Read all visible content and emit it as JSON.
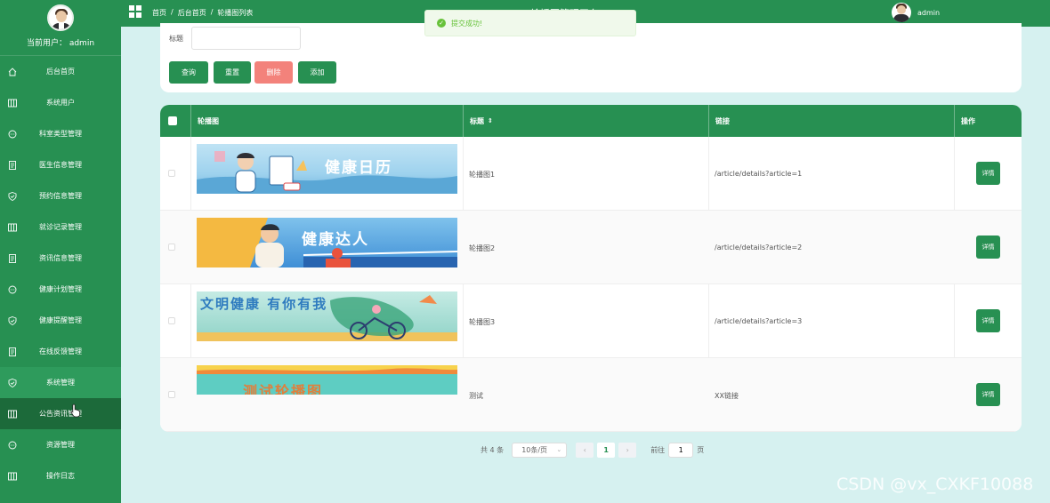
{
  "sidebar": {
    "current_user": "当前用户： admin",
    "items": [
      {
        "label": "后台首页",
        "icon": "home-icon"
      },
      {
        "label": "系统用户",
        "icon": "columns-icon"
      },
      {
        "label": "科室类型管理",
        "icon": "chat-icon"
      },
      {
        "label": "医生信息管理",
        "icon": "document-icon"
      },
      {
        "label": "预约信息管理",
        "icon": "shield-check-icon"
      },
      {
        "label": "就诊记录管理",
        "icon": "columns-icon"
      },
      {
        "label": "资讯信息管理",
        "icon": "document-icon"
      },
      {
        "label": "健康计划管理",
        "icon": "chat-icon"
      },
      {
        "label": "健康提醒管理",
        "icon": "shield-check-icon"
      },
      {
        "label": "在线反馈管理",
        "icon": "document-icon"
      },
      {
        "label": "系统管理",
        "icon": "shield-check-icon"
      },
      {
        "label": "公告资讯管理",
        "icon": "columns-icon"
      },
      {
        "label": "资源管理",
        "icon": "chat-icon"
      },
      {
        "label": "操作日志",
        "icon": "columns-icon"
      }
    ]
  },
  "header": {
    "breadcrumb": [
      "首页",
      "/",
      "后台首页",
      "/",
      "轮播图列表"
    ],
    "system_title": "轮播图管理平台",
    "user": "admin"
  },
  "toast": {
    "message": "提交成功!"
  },
  "search": {
    "label": "标题",
    "placeholder": "",
    "buttons": {
      "query": "查询",
      "reset": "重置",
      "delete": "删除",
      "add": "添加"
    }
  },
  "table": {
    "headers": {
      "image": "轮播图",
      "title": "标题",
      "link": "链接",
      "action": "操作"
    },
    "rows": [
      {
        "banner_text": "健康日历",
        "title": "轮播图1",
        "link": "/article/details?article=1",
        "action": "详情"
      },
      {
        "banner_text": "健康达人",
        "title": "轮播图2",
        "link": "/article/details?article=2",
        "action": "详情"
      },
      {
        "banner_text": "文明健康 有你有我",
        "title": "轮播图3",
        "link": "/article/details?article=3",
        "action": "详情"
      },
      {
        "banner_text": "测试轮播图",
        "title": "测试",
        "link": "XX链接",
        "action": "详情"
      }
    ]
  },
  "pagination": {
    "total": "共 4 条",
    "page_size": "10条/页",
    "current_page": "1",
    "goto_label": "前往",
    "goto_value": "1",
    "page_suffix": "页"
  },
  "watermark": "CSDN @vx_CXKF10088",
  "colors": {
    "primary": "#279052",
    "danger": "#f3827b",
    "background": "#d6f1f0",
    "success": "#67c23a"
  }
}
